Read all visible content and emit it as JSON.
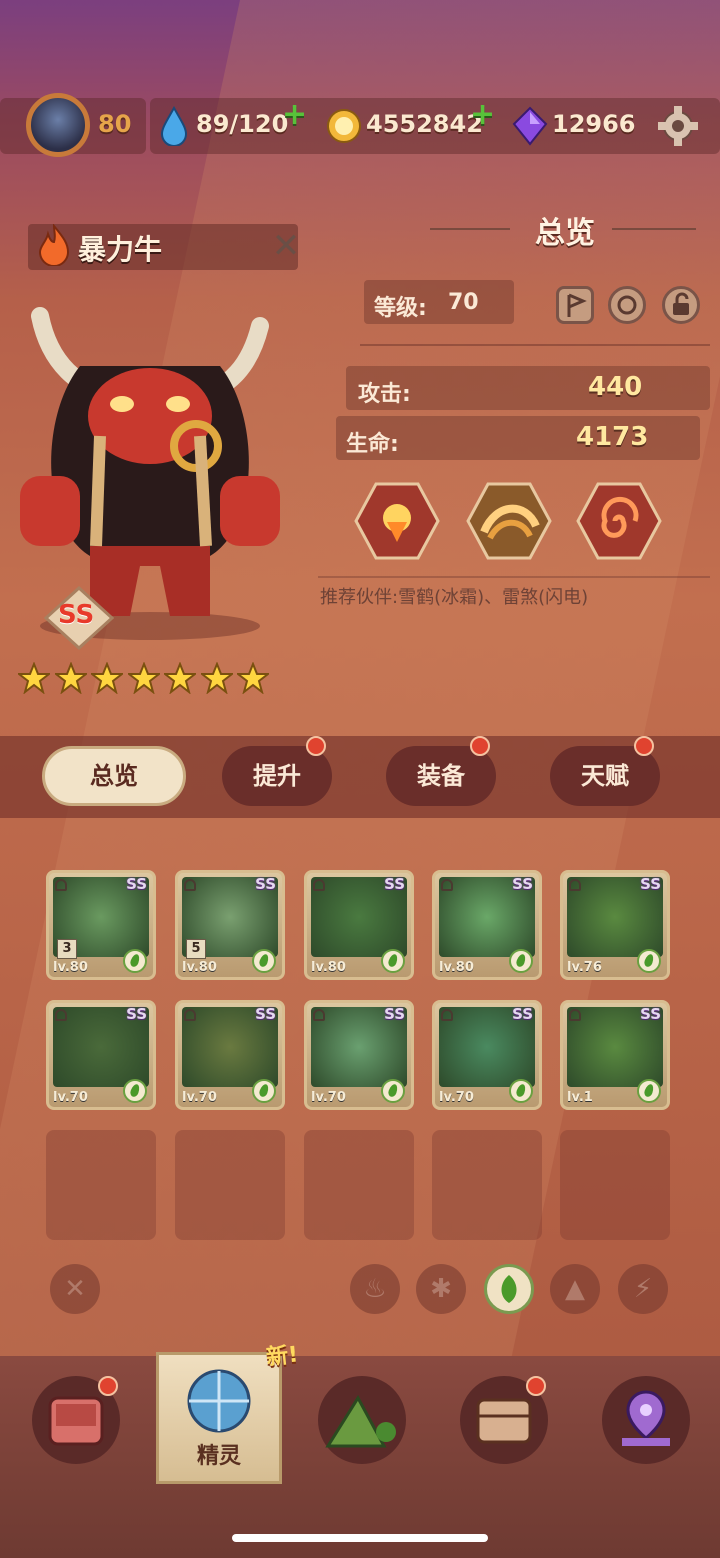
{
  "resources": {
    "player_level": "80",
    "stamina": "89/120",
    "coins": "4552842",
    "gems": "12966"
  },
  "hero": {
    "name": "暴力牛",
    "rank": "SS",
    "stars": 7
  },
  "overview": {
    "title": "总览",
    "level_label": "等级:",
    "level_value": "70",
    "attack_label": "攻击:",
    "attack_value": "440",
    "hp_label": "生命:",
    "hp_value": "4173",
    "recommend": "推荐伙伴:雪鹤(冰霜)、雷煞(闪电)"
  },
  "tabs": [
    {
      "label": "总览",
      "active": true,
      "dot": false
    },
    {
      "label": "提升",
      "active": false,
      "dot": true
    },
    {
      "label": "装备",
      "active": false,
      "dot": true
    },
    {
      "label": "天赋",
      "active": false,
      "dot": true
    }
  ],
  "cards": [
    {
      "level": "lv.80",
      "rank": "SS",
      "count": "3"
    },
    {
      "level": "lv.80",
      "rank": "SS",
      "count": "5"
    },
    {
      "level": "lv.80",
      "rank": "SS",
      "count": ""
    },
    {
      "level": "lv.80",
      "rank": "SS",
      "count": ""
    },
    {
      "level": "lv.76",
      "rank": "SS",
      "count": ""
    },
    {
      "level": "lv.70",
      "rank": "SS",
      "count": ""
    },
    {
      "level": "lv.70",
      "rank": "SS",
      "count": ""
    },
    {
      "level": "lv.70",
      "rank": "SS",
      "count": ""
    },
    {
      "level": "lv.70",
      "rank": "SS",
      "count": ""
    },
    {
      "level": "lv.1",
      "rank": "SS",
      "count": ""
    }
  ],
  "bottom_nav": {
    "active_label": "精灵",
    "new_badge": "新!"
  },
  "colors": {
    "accent_red_dot": "#e0432f",
    "nature_green": "#4a9a2a",
    "value_gold": "#ffe8a0"
  }
}
